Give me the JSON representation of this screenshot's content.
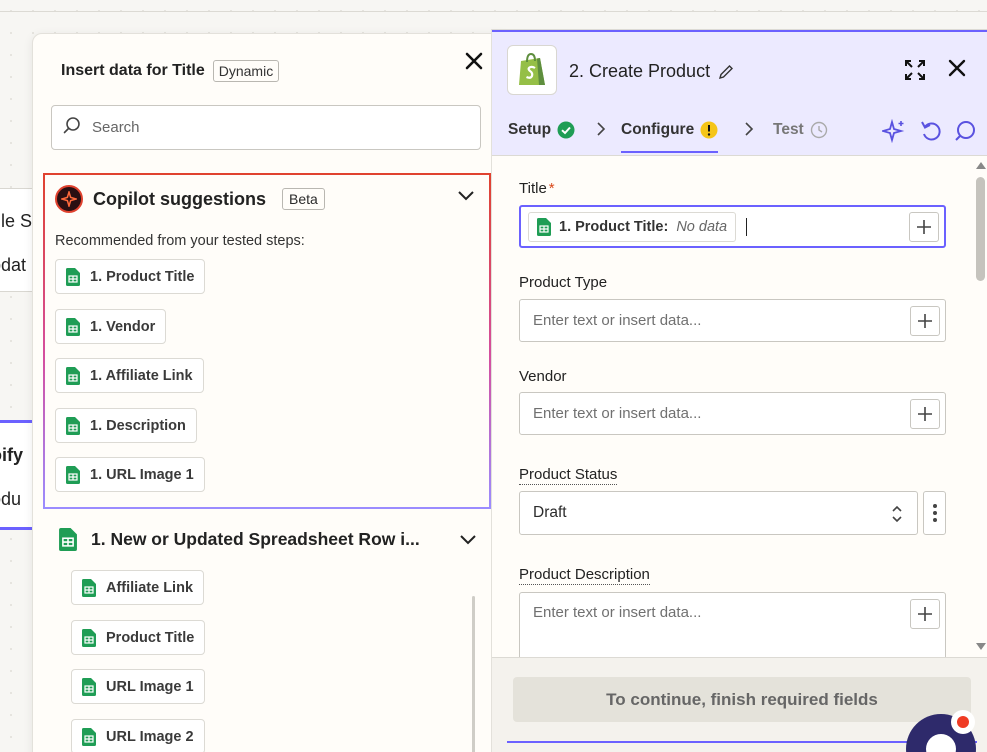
{
  "background": {
    "node_a_line1": "gle S",
    "node_a_line2": "pdat",
    "node_b_line1": "oify",
    "node_b_line2": "odu"
  },
  "insert_panel": {
    "title": "Insert data for Title",
    "badge": "Dynamic",
    "search_placeholder": "Search",
    "copilot": {
      "title": "Copilot suggestions",
      "badge": "Beta",
      "subtitle": "Recommended from your tested steps:",
      "suggestions": [
        "1. Product Title",
        "1. Vendor",
        "1. Affiliate Link",
        "1. Description",
        "1. URL Image 1"
      ]
    },
    "step": {
      "title": "1.  New or Updated Spreadsheet Row i...",
      "fields": [
        "Affiliate Link",
        "Product Title",
        "URL Image 1",
        "URL Image 2"
      ]
    }
  },
  "right_panel": {
    "title": "2. Create Product",
    "tabs": {
      "setup": "Setup",
      "configure": "Configure",
      "test": "Test"
    },
    "fields": {
      "title_label": "Title",
      "title_required": "*",
      "title_token_name": "1. Product Title:",
      "title_token_value": "No data",
      "product_type_label": "Product Type",
      "product_type_placeholder": "Enter text or insert data...",
      "vendor_label": "Vendor",
      "vendor_placeholder": "Enter text or insert data...",
      "status_label": "Product Status",
      "status_value": "Draft",
      "description_label": "Product Description",
      "description_placeholder": "Enter text or insert data..."
    },
    "continue_button": "To continue, finish required fields"
  },
  "colors": {
    "accent": "#6b61ff",
    "sheets_green": "#1f9d55",
    "warning_yellow": "#f5c518",
    "error_red": "#ef3b24"
  }
}
